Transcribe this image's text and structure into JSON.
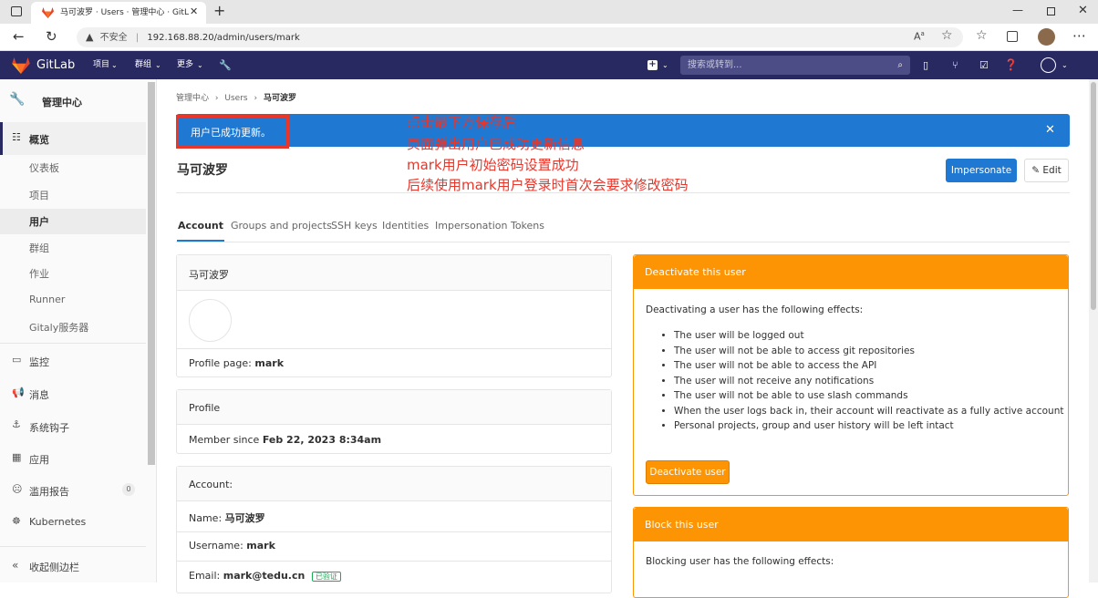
{
  "browser": {
    "tab_title": "马可波罗 · Users · 管理中心 · GitL",
    "security_label": "不安全",
    "url": "192.168.88.20/admin/users/mark"
  },
  "gitlab_nav": {
    "logo_text": "GitLab",
    "projects": "项目",
    "groups": "群组",
    "more": "更多",
    "search_placeholder": "搜索或转到..."
  },
  "sidebar": {
    "title": "管理中心",
    "overview": "概览",
    "items": [
      "仪表板",
      "项目",
      "用户",
      "群组",
      "作业",
      "Runner",
      "Gitaly服务器"
    ],
    "monitoring": "监控",
    "messages": "消息",
    "system_hooks": "系统钩子",
    "applications": "应用",
    "abuse_reports": "滥用报告",
    "abuse_count": "0",
    "kubernetes": "Kubernetes",
    "collapse": "收起侧边栏"
  },
  "breadcrumb": {
    "root": "管理中心",
    "users": "Users",
    "current": "马可波罗"
  },
  "flash": {
    "message": "用户已成功更新。"
  },
  "annotation": {
    "lines": [
      "点击最下方保存后",
      "页面弹出用户已成功更新信息",
      "mark用户初始密码设置成功",
      "后续使用mark用户登录时首次会要求修改密码"
    ]
  },
  "user_header": {
    "name": "马可波罗",
    "impersonate": "Impersonate",
    "edit": "Edit"
  },
  "tabs": [
    "Account",
    "Groups and projects",
    "SSH keys",
    "Identities",
    "Impersonation Tokens"
  ],
  "profile_card": {
    "name": "马可波罗",
    "profile_label": "Profile page:",
    "profile_value": "mark"
  },
  "profile2": {
    "title": "Profile",
    "member_label": "Member since",
    "member_value": "Feb 22, 2023 8:34am"
  },
  "account": {
    "title": "Account:",
    "name_label": "Name:",
    "name_value": "马可波罗",
    "username_label": "Username:",
    "username_value": "mark",
    "email_label": "Email:",
    "email_value": "mark@tedu.cn",
    "verified": "已验证"
  },
  "deactivate": {
    "title": "Deactivate this user",
    "intro": "Deactivating a user has the following effects:",
    "effects": [
      "The user will be logged out",
      "The user will not be able to access git repositories",
      "The user will not be able to access the API",
      "The user will not receive any notifications",
      "The user will not be able to use slash commands",
      "When the user logs back in, their account will reactivate as a fully active account",
      "Personal projects, group and user history will be left intact"
    ],
    "button": "Deactivate user"
  },
  "block": {
    "title": "Block this user",
    "intro": "Blocking user has the following effects:"
  },
  "colors": {
    "nav": "#292961",
    "flash": "#1f78d1",
    "orange": "#fc9403",
    "annotation": "#e8362b"
  }
}
